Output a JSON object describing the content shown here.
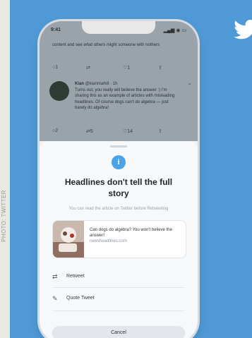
{
  "credit": "PHOTO: TWITTER",
  "status_bar": {
    "time": "9:41",
    "signal": "▂▄▆ ◉ ▭"
  },
  "feed": {
    "tweet1_text": "content and see what others might someone with nothers",
    "tweet1_actions": {
      "reply": "○1",
      "retweet": "⇄",
      "like": "♡1",
      "share": "⇪"
    },
    "tweet2": {
      "name": "Kian",
      "handle": "@kianmark8 · 1h",
      "more": "⌄",
      "text": "Turns out, you really will believe the answer :) I'm sharing this as an example of articles with misleading headlines. Of course dogs can't do algebra — just barely do algebra!"
    },
    "tweet2_actions": {
      "reply": "○2",
      "retweet": "⇄5",
      "like": "♡14",
      "share": "⇪"
    }
  },
  "sheet": {
    "info_icon": "i",
    "headline": "Headlines don't tell the full story",
    "subtext": "You can read the article on Twitter before Retweeting",
    "card": {
      "title": "Can dogs do algebra? You won't believe the answer!",
      "domain": "newsheadlines.com"
    },
    "retweet_label": "Retweet",
    "quote_label": "Quote Tweet",
    "cancel_label": "Cancel"
  },
  "colors": {
    "background": "#4f9ad6",
    "accent": "#4aa3e8"
  },
  "icons": {
    "logo": "twitter-bird-icon",
    "retweet": "retweet-icon",
    "quote": "quote-pen-icon"
  }
}
